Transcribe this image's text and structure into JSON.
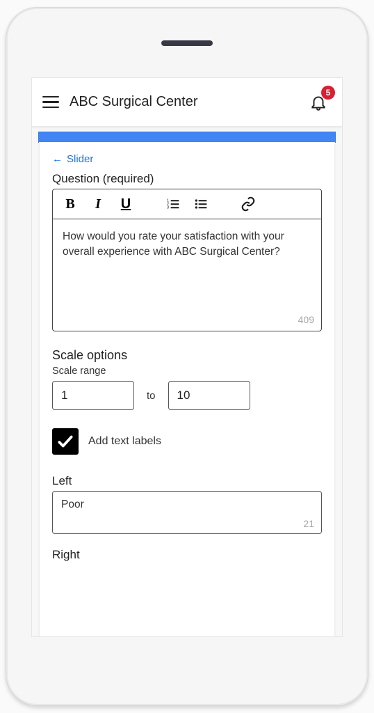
{
  "header": {
    "title": "ABC Surgical Center",
    "notification_count": "5"
  },
  "back": {
    "arrow": "←",
    "label": "Slider"
  },
  "question": {
    "label": "Question (required)",
    "text": "How would you rate your satisfaction with your overall experience with ABC Surgical Center?",
    "char_count": "409"
  },
  "scale": {
    "title": "Scale options",
    "range_label": "Scale range",
    "min": "1",
    "to": "to",
    "max": "10"
  },
  "labels_checkbox": {
    "label": "Add text labels",
    "checked": true
  },
  "left": {
    "label": "Left",
    "value": "Poor",
    "char_count": "21"
  },
  "right": {
    "label": "Right"
  },
  "toolbar": {
    "bold": "B",
    "italic": "I",
    "underline": "U"
  }
}
